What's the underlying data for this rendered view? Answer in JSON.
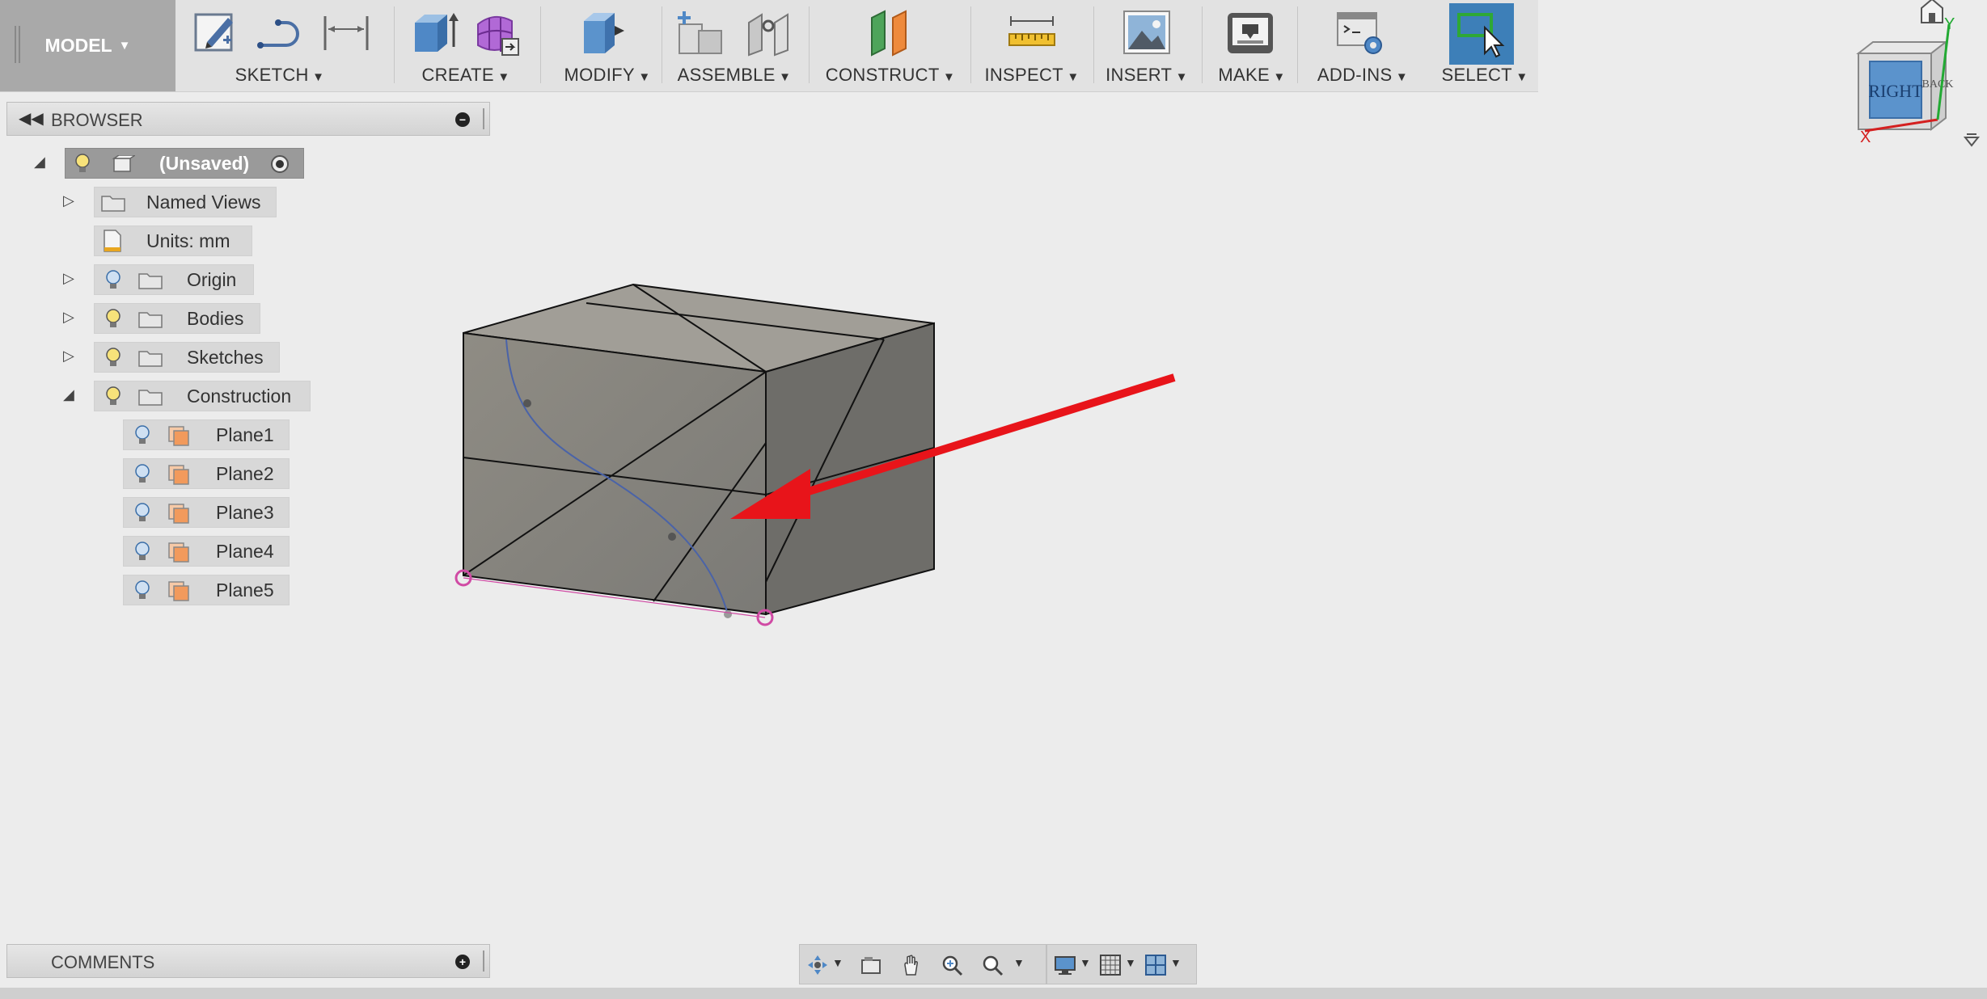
{
  "toolbar": {
    "model_label": "MODEL",
    "groups": [
      {
        "label": "SKETCH"
      },
      {
        "label": "CREATE"
      },
      {
        "label": "MODIFY"
      },
      {
        "label": "ASSEMBLE"
      },
      {
        "label": "CONSTRUCT"
      },
      {
        "label": "INSPECT"
      },
      {
        "label": "INSERT"
      },
      {
        "label": "MAKE"
      },
      {
        "label": "ADD-INS"
      },
      {
        "label": "SELECT"
      }
    ]
  },
  "browser": {
    "title": "BROWSER",
    "root": "(Unsaved)",
    "items": [
      {
        "label": "Named Views"
      },
      {
        "label": "Units: mm"
      },
      {
        "label": "Origin"
      },
      {
        "label": "Bodies"
      },
      {
        "label": "Sketches"
      },
      {
        "label": "Construction"
      }
    ],
    "planes": [
      "Plane1",
      "Plane2",
      "Plane3",
      "Plane4",
      "Plane5"
    ]
  },
  "comments": {
    "title": "COMMENTS"
  },
  "viewcube": {
    "face_right": "RIGHT",
    "face_back": "BACK",
    "axis_x": "X",
    "axis_y": "Y"
  },
  "colors": {
    "accent_arrow": "#e8141a",
    "select_blue": "#3d7fb8",
    "sketch_curve": "#4a63a8"
  }
}
